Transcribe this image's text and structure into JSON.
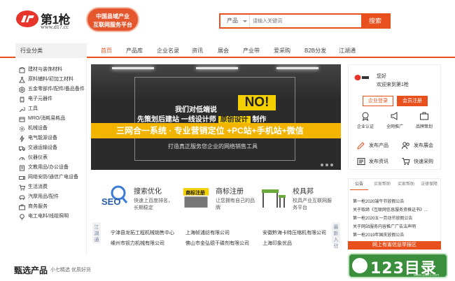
{
  "header": {
    "logo_text": "第1枪",
    "logo_url": "www.d17.cc",
    "badge_line1": "中国县域产业",
    "badge_line2": "互联网服务平台",
    "search": {
      "category": "产品",
      "placeholder": "请输入关键词",
      "button": "搜索"
    }
  },
  "nav": {
    "category_title": "行业分类",
    "items": [
      "首页",
      "产品库",
      "企业名录",
      "资讯",
      "展会",
      "产业带",
      "爱采购",
      "B2B分发",
      "江湖通"
    ]
  },
  "sidebar": {
    "items": [
      "建材与装饰材料",
      "原料辅料/初加工材料",
      "五金零部件/配件/备品备件",
      "电子元器件",
      "工具",
      "MRO/消耗易耗品",
      "机械设备",
      "电气能源设备",
      "交通运输设备",
      "仪器仪表",
      "文教用品/办公设备",
      "网络安防/通信广电设备",
      "生活消费",
      "汽摩用品/配件",
      "商务服务",
      "电工电料/线缆照明"
    ]
  },
  "banner": {
    "line1": "我们对低端说",
    "no": "NO!",
    "line2_a": "先策划后建站  一线设计师",
    "line2_b": "原创设计",
    "line2_c": "制作",
    "strip": "三网合一系统 · 专业营销定位 +PC站+手机站+微信",
    "line3": "打造真正服务您企业的网络销售工具"
  },
  "user_panel": {
    "hello": "您好",
    "welcome": "欢迎来到第1枪",
    "login": "企业登录",
    "register": "会员注册",
    "icons": [
      {
        "label": "企业认证",
        "icon": "certify-icon"
      },
      {
        "label": "全网推广",
        "icon": "promote-icon"
      },
      {
        "label": "品牌策划",
        "icon": "brand-icon"
      }
    ],
    "actions": [
      {
        "label": "发布产品",
        "icon": "publish-product-icon"
      },
      {
        "label": "发布展会",
        "icon": "publish-exhibition-icon"
      },
      {
        "label": "发布资讯",
        "icon": "publish-news-icon"
      },
      {
        "label": "快速采购",
        "icon": "quick-purchase-icon"
      }
    ]
  },
  "features": [
    {
      "title": "搜索优化",
      "desc": "快速上百度排名，长期稳定"
    },
    {
      "title": "商标注册",
      "desc": "让您拥有自己的品牌"
    },
    {
      "title": "校具邦",
      "desc": "校具产业互联网服务平台"
    }
  ],
  "feature_badges": {
    "seo": "SEO",
    "trademark": "商标注册"
  },
  "company_tabs": {
    "left": "江湖通",
    "right": "最新入驻"
  },
  "companies": [
    [
      "宁津县龙拓工程机械销售中心",
      "上海帧浦纺有限公司",
      "安徽黔海卡特压缩机有限公司"
    ],
    [
      "嵊州市钡力机械有限公司",
      "佛山市金弘德干磷剂有限公司",
      "上海印象优品"
    ]
  ],
  "notice": {
    "tabs": [
      "公告",
      "买家帮助",
      "买家帮助",
      "法律保障"
    ],
    "lines": [
      "第一枪2020端午节放假公告",
      "关于取缔《互联网信息服务资格证书》...",
      "第一枪2020五一劳动节放假公告",
      "关于网站服务内容推广广告法声明",
      "第一枪2019年国庆放假公告"
    ],
    "report": "网上有害信息举报区"
  },
  "section": {
    "title": "甄选产品",
    "subtitle": "小七精选  优质好货"
  },
  "watermark": {
    "text": "123目录",
    "url": "www.11223.com"
  },
  "colors": {
    "accent": "#e8501d",
    "banner_yellow": "#f3b400",
    "watermark_green": "#3a8e3c"
  }
}
